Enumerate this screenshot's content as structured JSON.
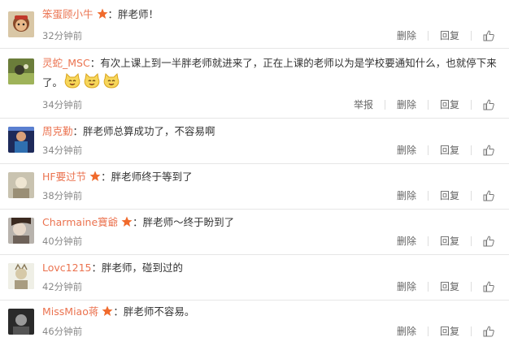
{
  "comments": [
    {
      "username": "笨蛋顾小牛",
      "star": true,
      "text": "：胖老师！",
      "time": "32分钟前",
      "report": "",
      "delete": "删除",
      "reply": "回复",
      "emojis": 0
    },
    {
      "username": "灵蛇_MSC",
      "star": false,
      "text": "：有次上课上到一半胖老师就进来了，正在上课的老师以为是学校要通知什么，也就停下来了。",
      "time": "34分钟前",
      "report": "举报",
      "delete": "删除",
      "reply": "回复",
      "emojis": 3
    },
    {
      "username": "周克勤",
      "star": false,
      "text": "：胖老师总算成功了，不容易啊",
      "time": "34分钟前",
      "report": "",
      "delete": "删除",
      "reply": "回复",
      "emojis": 0
    },
    {
      "username": "HF要过节",
      "star": true,
      "text": "：胖老师终于等到了",
      "time": "38分钟前",
      "report": "",
      "delete": "删除",
      "reply": "回复",
      "emojis": 0
    },
    {
      "username": "Charmaine寶爺",
      "star": true,
      "text": "：胖老师～终于盼到了",
      "time": "40分钟前",
      "report": "",
      "delete": "删除",
      "reply": "回复",
      "emojis": 0
    },
    {
      "username": "Lovc1215",
      "star": false,
      "text": "：胖老师，碰到过的",
      "time": "42分钟前",
      "report": "",
      "delete": "删除",
      "reply": "回复",
      "emojis": 0
    },
    {
      "username": "MissMiao蒋",
      "star": true,
      "text": "：胖老师不容易。",
      "time": "46分钟前",
      "report": "",
      "delete": "删除",
      "reply": "回复",
      "emojis": 0
    }
  ],
  "icons": {
    "star": "orange-star-icon",
    "like": "thumbs-up-icon",
    "emoji": "cat-face-emoji-icon"
  },
  "colors": {
    "username": "#eb7350",
    "text": "#333333",
    "time": "#888888",
    "action": "#666666"
  }
}
